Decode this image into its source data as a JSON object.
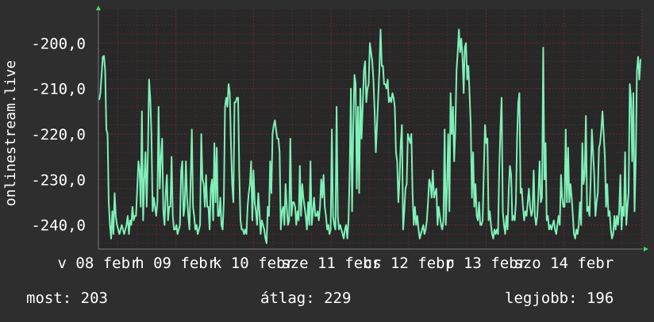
{
  "chart_data": {
    "type": "line",
    "ylabel": "onlinestream.live",
    "ylim": [
      -245.3,
      -192.6
    ],
    "y_ticks": [
      {
        "value": -200,
        "label": "-200,0"
      },
      {
        "value": -210,
        "label": "-210,0"
      },
      {
        "value": -220,
        "label": "-220,0"
      },
      {
        "value": -230,
        "label": "-230,0"
      },
      {
        "value": -240,
        "label": "-240,0"
      }
    ],
    "x_labels": [
      "v 08 febr",
      "h 09 febr",
      "k 10 febr",
      "sze 11 febr",
      "cs 12 febr",
      "p 13 febr",
      "szo 14 febr"
    ],
    "colors": {
      "background": "#2e2e2e",
      "plot_background": "#282828",
      "grid": "#6e2a2a",
      "line": "#7ef0b8",
      "axis_arrow": "#3fe060"
    },
    "series": [
      {
        "values": [
          -212.5,
          -211,
          -207,
          -203,
          -202.8,
          -206,
          -219,
          -220,
          -235,
          -240,
          -243,
          -237,
          -242,
          -233,
          -238,
          -240,
          -241,
          -242,
          -241,
          -240,
          -241,
          -242,
          -241,
          -240,
          -238,
          -242,
          -239,
          -240,
          -236,
          -239,
          -238,
          -238,
          -232,
          -226,
          -228,
          -236,
          -215,
          -239,
          -230,
          -224,
          -236,
          -225,
          -208,
          -212,
          -220,
          -237,
          -234,
          -236,
          -238,
          -235,
          -214,
          -232,
          -225,
          -221,
          -237,
          -240,
          -233,
          -229,
          -239,
          -236,
          -236,
          -225,
          -238,
          -241,
          -241,
          -240,
          -242,
          -241,
          -240,
          -228,
          -226,
          -238,
          -236,
          -226,
          -234,
          -238,
          -241,
          -230,
          -219,
          -236,
          -238,
          -241,
          -240,
          -242,
          -241,
          -240,
          -220,
          -230,
          -231,
          -236,
          -229,
          -236,
          -236,
          -241,
          -232,
          -230,
          -239,
          -222,
          -235,
          -223,
          -238,
          -238,
          -234,
          -240,
          -241,
          -235,
          -214,
          -212,
          -214,
          -209,
          -211,
          -222,
          -231,
          -235,
          -213,
          -213,
          -212,
          -212,
          -229,
          -239,
          -241,
          -241,
          -242,
          -241,
          -242,
          -236,
          -233,
          -231,
          -226,
          -239,
          -228,
          -235,
          -237,
          -240,
          -233,
          -237,
          -242,
          -239,
          -240,
          -241,
          -243,
          -244,
          -236,
          -238,
          -226,
          -233,
          -220,
          -218,
          -217,
          -219,
          -221,
          -221,
          -224,
          -241,
          -237,
          -236,
          -240,
          -231,
          -236,
          -240,
          -239,
          -221,
          -238,
          -235,
          -235,
          -236,
          -240,
          -237,
          -239,
          -227,
          -238,
          -231,
          -234,
          -236,
          -238,
          -241,
          -235,
          -240,
          -226,
          -240,
          -237,
          -234,
          -238,
          -238,
          -237,
          -239,
          -236,
          -230,
          -234,
          -229,
          -236,
          -238,
          -241,
          -240,
          -242,
          -241,
          -219,
          -238,
          -240,
          -241,
          -214,
          -238,
          -241,
          -240,
          -241,
          -242,
          -243,
          -241,
          -240,
          -243,
          -239,
          -228,
          -210,
          -237,
          -219,
          -207,
          -209,
          -232,
          -214,
          -233,
          -210,
          -221,
          -214,
          -206,
          -204,
          -213,
          -210,
          -209,
          -200,
          -202,
          -204,
          -208,
          -215,
          -224,
          -218,
          -212,
          -206,
          -197,
          -205,
          -205,
          -209,
          -209,
          -210,
          -208,
          -213,
          -212,
          -213,
          -211,
          -212,
          -214,
          -224,
          -226,
          -235,
          -230,
          -222,
          -218,
          -241,
          -237,
          -232,
          -231,
          -220,
          -221,
          -222,
          -220,
          -233,
          -240,
          -236,
          -240,
          -238,
          -241,
          -243,
          -242,
          -241,
          -240,
          -242,
          -241,
          -239,
          -235,
          -230,
          -231,
          -234,
          -228,
          -234,
          -233,
          -232,
          -240,
          -236,
          -238,
          -240,
          -241,
          -239,
          -219,
          -240,
          -232,
          -220,
          -237,
          -211,
          -220,
          -214,
          -226,
          -219,
          -206,
          -202,
          -197,
          -202,
          -199,
          -203,
          -211,
          -201,
          -200,
          -208,
          -205,
          -211,
          -218,
          -234,
          -224,
          -236,
          -231,
          -238,
          -239,
          -235,
          -240,
          -240,
          -239,
          -228,
          -218,
          -222,
          -221,
          -239,
          -237,
          -240,
          -242,
          -243,
          -241,
          -242,
          -241,
          -242,
          -228,
          -219,
          -212,
          -237,
          -240,
          -242,
          -238,
          -241,
          -232,
          -227,
          -229,
          -239,
          -238,
          -239,
          -235,
          -221,
          -213,
          -211,
          -233,
          -232,
          -236,
          -239,
          -237,
          -238,
          -235,
          -232,
          -236,
          -238,
          -237,
          -228,
          -238,
          -240,
          -238,
          -233,
          -226,
          -235,
          -234,
          -201,
          -230,
          -222,
          -239,
          -238,
          -241,
          -240,
          -241,
          -240,
          -239,
          -241,
          -242,
          -240,
          -238,
          -240,
          -229,
          -234,
          -236,
          -236,
          -219,
          -235,
          -223,
          -235,
          -231,
          -234,
          -238,
          -242,
          -243,
          -241,
          -242,
          -240,
          -235,
          -240,
          -222,
          -231,
          -229,
          -216,
          -237,
          -236,
          -238,
          -230,
          -219,
          -224,
          -229,
          -238,
          -235,
          -233,
          -223,
          -222,
          -219,
          -215,
          -220,
          -225,
          -236,
          -231,
          -238,
          -237,
          -241,
          -243,
          -242,
          -238,
          -241,
          -238,
          -240,
          -237,
          -229,
          -241,
          -236,
          -238,
          -224,
          -240,
          -236,
          -233,
          -209,
          -212,
          -226,
          -211,
          -237,
          -226,
          -206,
          -203,
          -208,
          -203.5
        ]
      }
    ]
  },
  "stats": {
    "current": "most: 203",
    "average": "átlag: 229",
    "best": "legjobb: 196"
  }
}
